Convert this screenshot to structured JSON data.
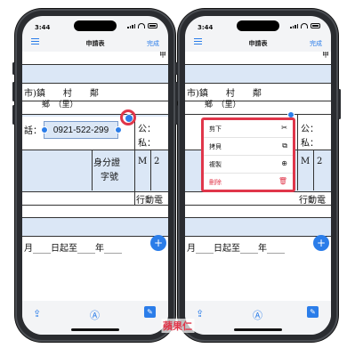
{
  "status": {
    "time": "3:44"
  },
  "nav": {
    "title": "申請表",
    "done": "完成"
  },
  "doc": {
    "top_char": "甲",
    "city_line": "市)鎮　　村　　鄰",
    "li_line": "鄉　（里）",
    "phone_label": "話：",
    "phone_value": "0921-522-299",
    "gong": "公：",
    "si": "私：",
    "id_label_1": "身分證",
    "id_label_2": "字號",
    "gender": "M",
    "digit": "2",
    "mobile_label": "行動電",
    "bottom_line": "月____日起至____年____"
  },
  "menu": {
    "items": [
      {
        "label": "剪下",
        "icon": "scissors-icon",
        "glyph": "✂"
      },
      {
        "label": "拷貝",
        "icon": "copy-icon",
        "glyph": "⧉"
      },
      {
        "label": "複製",
        "icon": "duplicate-icon",
        "glyph": "⊕"
      },
      {
        "label": "刪除",
        "icon": "trash-icon",
        "glyph": "🗑"
      }
    ]
  },
  "watermark": "蘋果仁",
  "colors": {
    "accent": "#2b7de9",
    "highlight": "#e0364a",
    "field_bg": "#dbe7f6"
  }
}
